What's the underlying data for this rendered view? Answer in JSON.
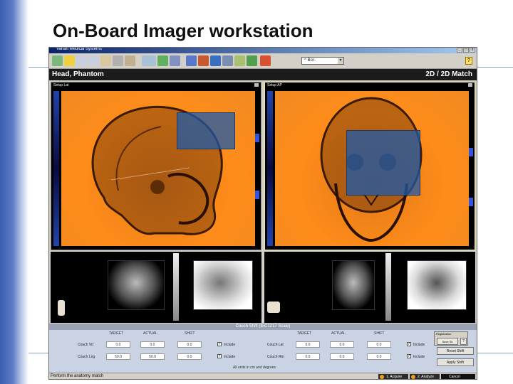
{
  "slide": {
    "title": "On-Board Imager workstation"
  },
  "app": {
    "window_title": "Varian Medical Systems",
    "window_buttons": [
      "_",
      "□",
      "x"
    ],
    "toolbar": {
      "icons": [
        "hand-icon",
        "brightness-icon",
        "zoom-in-icon",
        "zoom-out-icon",
        "measure-icon",
        "point-icon",
        "ruler-icon",
        "window-level-icon",
        "crosshair-icon",
        "grid-icon",
        "blend-icon",
        "layout-icon",
        "image-icon",
        "spot-icon",
        "color-icon",
        "contour-icon",
        "export-icon"
      ],
      "combo_value": "^ Bor-",
      "help_label": "?"
    },
    "header": {
      "patient": "Head, Phantom",
      "mode": "2D / 2D Match"
    },
    "views": [
      {
        "label": "Setup Lat"
      },
      {
        "label": "Setup AP"
      }
    ],
    "couch": {
      "title": "Couch Shift (IEC1217 Scale)",
      "columns": [
        "TARGET",
        "ACTUAL",
        "SHIFT"
      ],
      "left_rows": [
        {
          "label": "Couch Vrt",
          "target": "0.0",
          "actual": "0.0",
          "shift": "0.0",
          "include": "Include"
        },
        {
          "label": "Couch Lng",
          "target": "50.0",
          "actual": "50.0",
          "shift": "0.0",
          "include": "Include"
        }
      ],
      "right_rows": [
        {
          "label": "Couch Lat",
          "target": "0.0",
          "actual": "0.0",
          "shift": "0.0",
          "include": "Include"
        },
        {
          "label": "Couch Rtn",
          "target": "0.0",
          "actual": "0.0",
          "shift": "0.0",
          "include": "Include"
        }
      ],
      "units_note": "All units in cm and degrees",
      "shift_box": {
        "label": "Registration",
        "button": "Save Sh",
        "help": "?"
      },
      "reset_button": "Reset Shift",
      "apply_button": "Apply Shift"
    },
    "status": {
      "message": "Perform the anatomy match",
      "steps": [
        "1. Acquire",
        "2. Analyze",
        "Cancel"
      ]
    }
  }
}
